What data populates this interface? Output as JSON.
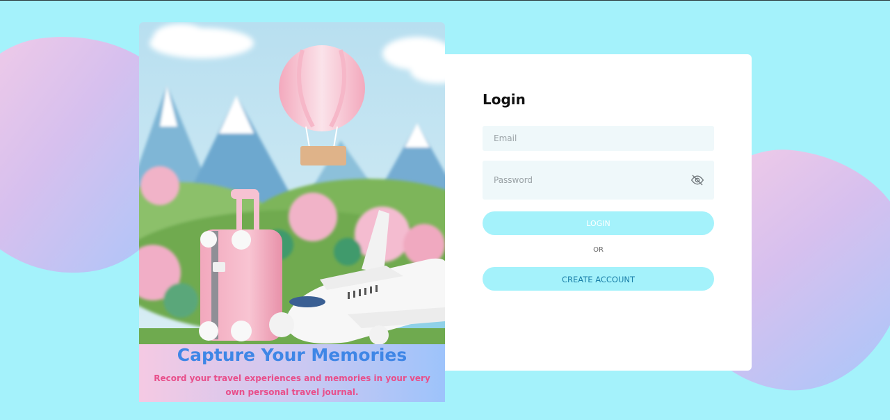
{
  "colors": {
    "background": "#a4f2fb",
    "hero_title": "#3f86e6",
    "hero_subtitle": "#e84f8b",
    "button_bg": "#a4f2fb",
    "create_account_text": "#1a7fa8",
    "input_bg": "#eff8fa"
  },
  "hero": {
    "image_icon": "travel-illustration",
    "title": "Capture Your Memories",
    "subtitle": "Record your travel experiences and memories in your very own personal travel journal."
  },
  "login": {
    "title": "Login",
    "email": {
      "placeholder": "Email",
      "value": ""
    },
    "password": {
      "placeholder": "Password",
      "value": "",
      "toggle_icon": "eye-off-icon"
    },
    "login_button": "LOGIN",
    "divider_text": "OR",
    "create_account_button": "CREATE ACCOUNT"
  }
}
